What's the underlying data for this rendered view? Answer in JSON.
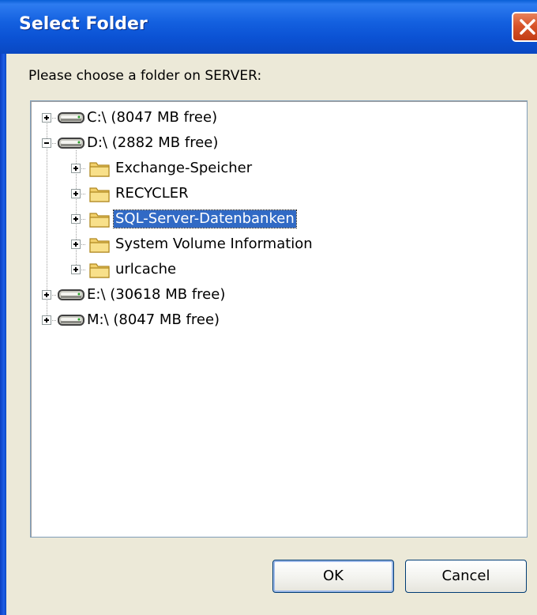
{
  "window": {
    "title": "Select Folder",
    "prompt": "Please choose a folder on SERVER:"
  },
  "tree": {
    "items": [
      {
        "label": "C:\\ (8047 MB free)",
        "type": "drive",
        "expanded": false,
        "level": 0,
        "selected": false
      },
      {
        "label": "D:\\ (2882 MB free)",
        "type": "drive",
        "expanded": true,
        "level": 0,
        "selected": false
      },
      {
        "label": "Exchange-Speicher",
        "type": "folder",
        "expanded": false,
        "level": 1,
        "selected": false
      },
      {
        "label": "RECYCLER",
        "type": "folder",
        "expanded": false,
        "level": 1,
        "selected": false
      },
      {
        "label": "SQL-Server-Datenbanken",
        "type": "folder",
        "expanded": false,
        "level": 1,
        "selected": true
      },
      {
        "label": "System Volume Information",
        "type": "folder",
        "expanded": false,
        "level": 1,
        "selected": false
      },
      {
        "label": "urlcache",
        "type": "folder",
        "expanded": false,
        "level": 1,
        "selected": false
      },
      {
        "label": "E:\\ (30618 MB free)",
        "type": "drive",
        "expanded": false,
        "level": 0,
        "selected": false
      },
      {
        "label": "M:\\ (8047 MB free)",
        "type": "drive",
        "expanded": false,
        "level": 0,
        "selected": false
      }
    ]
  },
  "buttons": {
    "ok": "OK",
    "cancel": "Cancel"
  },
  "colors": {
    "titlebar": "#0b52d4",
    "selection": "#316ac5",
    "dialog_bg": "#ece9d8",
    "close_button": "#d8542a"
  }
}
